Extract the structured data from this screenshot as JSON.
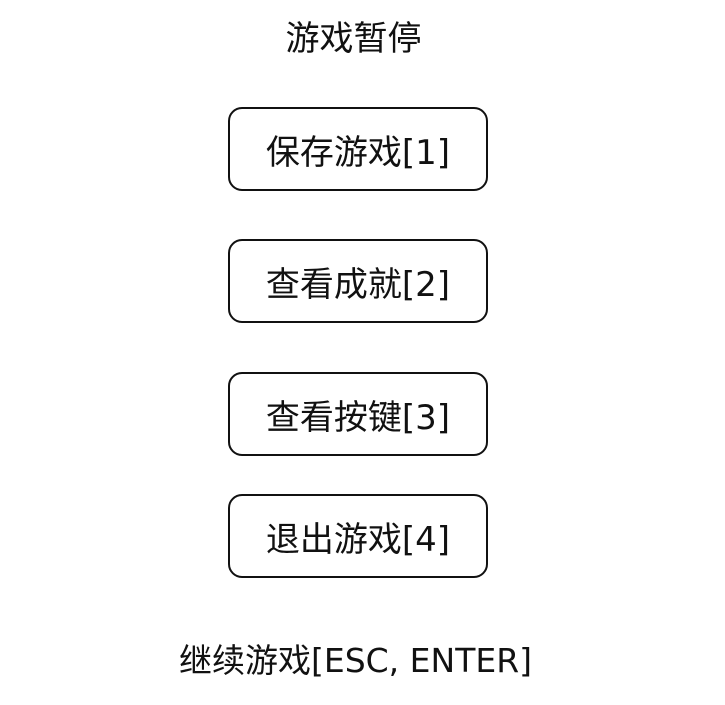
{
  "pause_menu": {
    "title": "游戏暂停",
    "buttons": [
      {
        "label": "保存游戏[1]"
      },
      {
        "label": "查看成就[2]"
      },
      {
        "label": "查看按键[3]"
      },
      {
        "label": "退出游戏[4]"
      }
    ],
    "continue_label": "继续游戏[ESC, ENTER]"
  }
}
